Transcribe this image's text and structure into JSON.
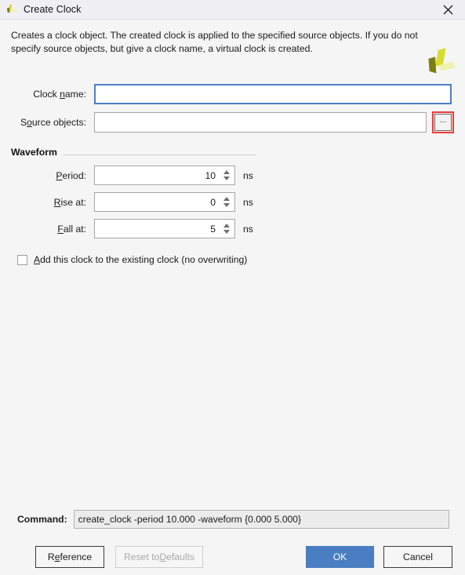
{
  "window": {
    "title": "Create Clock",
    "icon": "vivado-logo-icon",
    "close_label": "✕"
  },
  "description": {
    "text": "Creates a clock object. The created clock is applied to the specified source objects. If you do not specify source objects, but give a clock name, a virtual clock is created.",
    "logo": "vivado-logo-icon"
  },
  "form": {
    "clock_name": {
      "label_pre": "Clock ",
      "label_mnemonic": "n",
      "label_post": "ame:",
      "value": "",
      "placeholder": ""
    },
    "source_objects": {
      "label_pre": "S",
      "label_mnemonic": "o",
      "label_post": "urce objects:",
      "value": "",
      "placeholder": "",
      "browse_label": "..."
    }
  },
  "waveform": {
    "title": "Waveform",
    "fields": [
      {
        "label_pre": "",
        "label_mnemonic": "P",
        "label_post": "eriod:",
        "value": "10",
        "unit": "ns"
      },
      {
        "label_pre": "",
        "label_mnemonic": "R",
        "label_post": "ise at:",
        "value": "0",
        "unit": "ns"
      },
      {
        "label_pre": "",
        "label_mnemonic": "F",
        "label_post": "all at:",
        "value": "5",
        "unit": "ns"
      }
    ]
  },
  "checkbox": {
    "label_mnemonic": "A",
    "label_post": "dd this clock to the existing clock (no overwriting)",
    "checked": false
  },
  "command": {
    "label": "Command:",
    "value": "create_clock -period 10.000 -waveform {0.000 5.000}"
  },
  "buttons": {
    "reference": {
      "pre": "R",
      "mnemonic": "e",
      "post": "ference"
    },
    "reset": {
      "pre": "Reset to ",
      "mnemonic": "D",
      "post": "efaults",
      "enabled": false
    },
    "ok": {
      "label": "OK"
    },
    "cancel": {
      "label": "Cancel"
    }
  },
  "colors": {
    "accent_blue": "#4a7ec2",
    "highlight_red": "#ee3b33",
    "titlebar_bg": "#f0f0f4",
    "dialog_bg": "#f5f5f5",
    "logo_dark": "#7d7d13",
    "logo_mid": "#d9dc2f",
    "logo_light": "#eef2b0"
  }
}
